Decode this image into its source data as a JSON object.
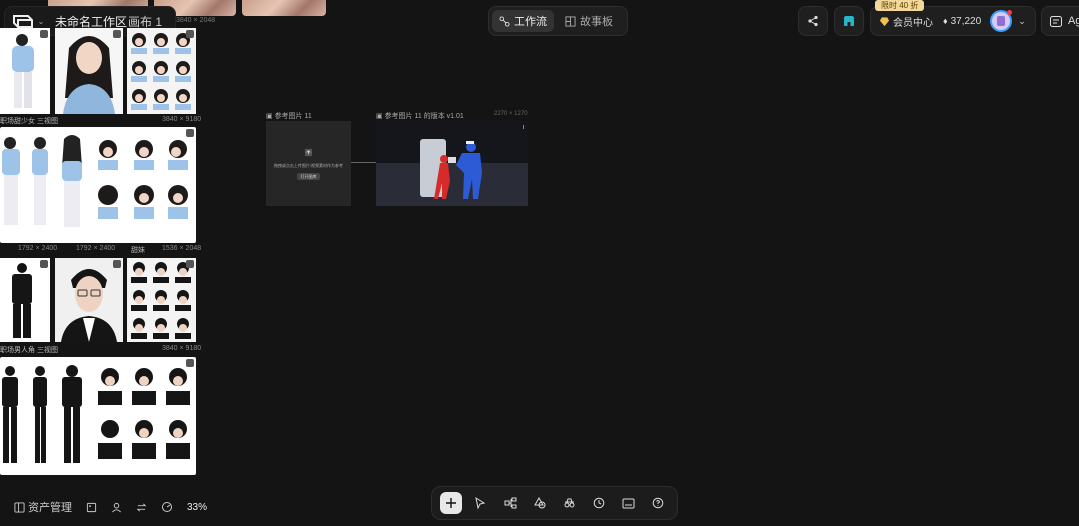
{
  "header": {
    "workspace_title": "未命名工作区",
    "canvas_menu": "画布 1",
    "tabs": [
      {
        "label": "工作流",
        "active": true
      },
      {
        "label": "故事板",
        "active": false
      }
    ],
    "promo_badge": "限时 40 折",
    "member_center": "会员中心",
    "credits": "37,220",
    "agent_label": "Ag"
  },
  "assets": {
    "card1": {
      "caption": "职场甜少女 三视图",
      "size": "3840 × 9180"
    },
    "card2": {
      "captions": [
        "1792 × 2400",
        "1792 × 2400",
        "1536 × 2048"
      ],
      "caption_prefix": "甜妹"
    },
    "card3": {
      "caption": "职场男人角 三视图",
      "size": "3840 × 9180"
    },
    "top_size": "3840 × 2048"
  },
  "nodes": {
    "node1": {
      "title": "参考图片 11",
      "hint": "拖拽或点击上传图片/视频素材作为参考",
      "button": "打开图库"
    },
    "node2": {
      "title": "参考图片 11 的版本 v1.01",
      "size": "2270 × 1270"
    }
  },
  "footer": {
    "asset_manage": "资产管理",
    "zoom": "33%"
  },
  "colors": {
    "background": "#141414",
    "accent_blue": "#2d5bd6",
    "accent_red": "#d62b2b",
    "promo": "#f3d89a"
  }
}
